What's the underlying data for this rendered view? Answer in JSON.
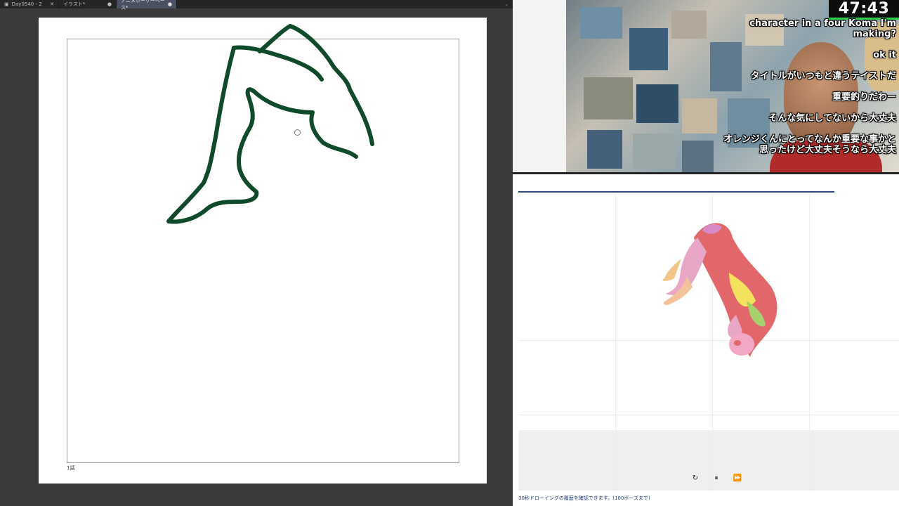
{
  "tabs": [
    {
      "label": "Day0540 - 2",
      "active": false
    },
    {
      "label": "イラスト*",
      "active": false
    },
    {
      "label": "アニメポーザーベース*",
      "active": true
    }
  ],
  "canvas": {
    "page_label": "1話",
    "stroke_color": "#0f4a2a"
  },
  "stream": {
    "timer": "47:43",
    "comments": [
      "character in a four Koma I'm making?",
      "ok it",
      "タイトルがいつもと違うテイストだ",
      "重要釣りだわー",
      "そんな気にしてないから大丈夫",
      "オレンジくんにとってなんか重要な事かと思ったけど大丈夫そうなら大丈夫"
    ]
  },
  "viewer": {
    "footnote": "30秒ドローイングの履歴を確認できます。(100ポーズまで)",
    "controls": {
      "restart": "↻",
      "pause": "⏸",
      "forward": "⏩"
    }
  },
  "colors": {
    "accent_line": "#2f4a75",
    "timer_bar": "#2fd24a"
  }
}
